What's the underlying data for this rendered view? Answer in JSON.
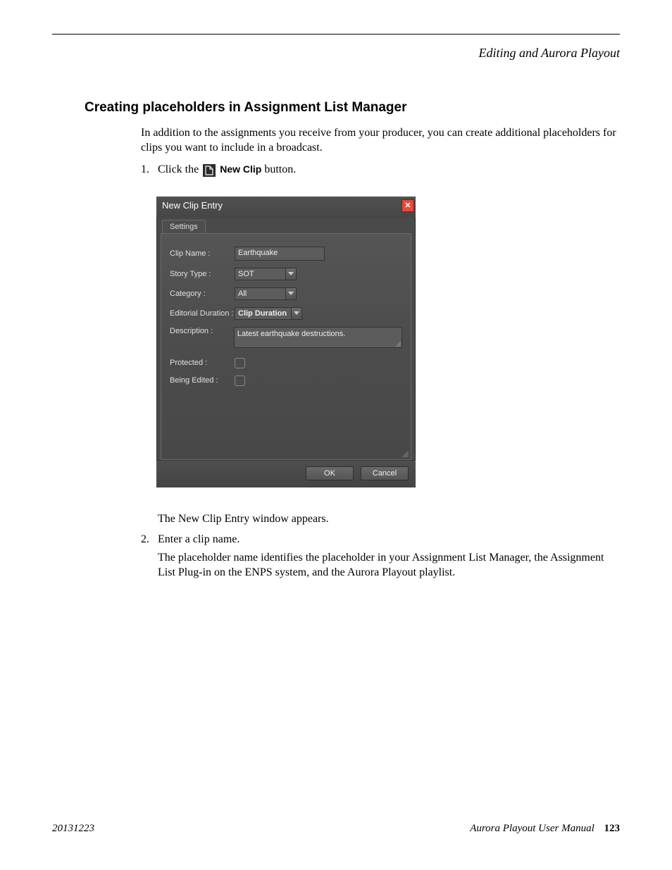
{
  "header": {
    "section": "Editing and Aurora Playout"
  },
  "heading": "Creating placeholders in Assignment List Manager",
  "intro": "In addition to the assignments you receive from your producer, you can create additional placeholders for clips you want to include in a broadcast.",
  "steps": {
    "s1": {
      "num": "1.",
      "pre": "Click the ",
      "icon_label": "New Clip",
      "post": " button."
    },
    "s1_after": "The New Clip Entry window appears.",
    "s2": {
      "num": "2.",
      "text": "Enter a clip name.",
      "detail": "The placeholder name identifies the placeholder in your Assignment List Manager, the Assignment List Plug-in on the ENPS system, and the Aurora Playout playlist."
    }
  },
  "dialog": {
    "title": "New Clip Entry",
    "tab": "Settings",
    "labels": {
      "clip_name": "Clip Name :",
      "story_type": "Story Type :",
      "category": "Category :",
      "editorial_duration": "Editorial Duration :",
      "description": "Description :",
      "protected": "Protected :",
      "being_edited": "Being Edited :"
    },
    "values": {
      "clip_name": "Earthquake",
      "story_type": "SOT",
      "category": "All",
      "editorial_duration": "Clip Duration",
      "description": "Latest earthquake destructions."
    },
    "buttons": {
      "ok": "OK",
      "cancel": "Cancel"
    }
  },
  "footer": {
    "date": "20131223",
    "book": "Aurora Playout   User Manual",
    "page": "123"
  }
}
